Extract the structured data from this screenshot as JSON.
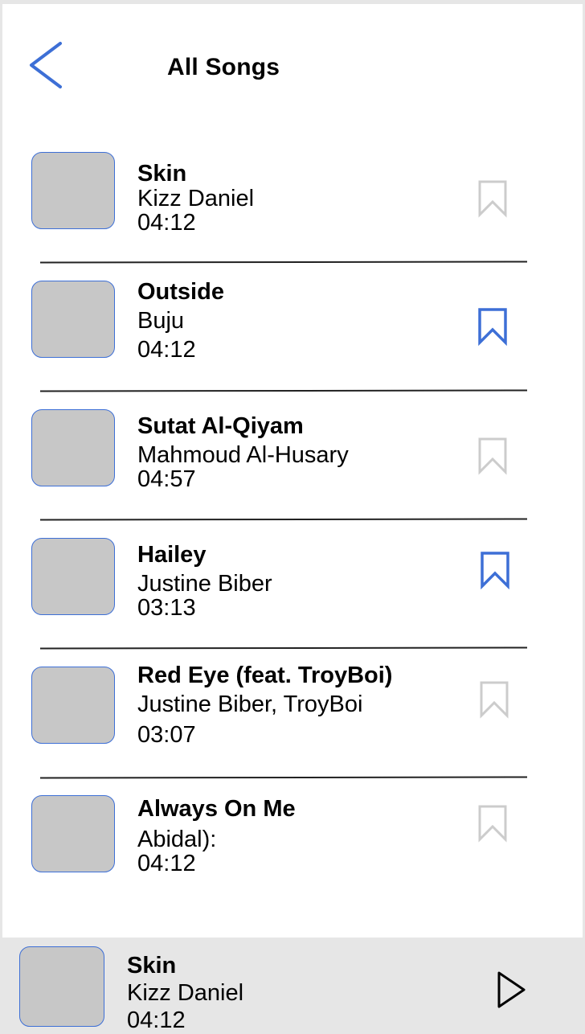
{
  "header": {
    "title": "All Songs",
    "back_icon": "chevron-left-icon"
  },
  "colors": {
    "accent": "#3d6fd6",
    "thumbnail": "#c7c7c7",
    "bookmark_inactive": "#cccccc",
    "player_bg": "#e6e6e6"
  },
  "songs": [
    {
      "title": "Skin",
      "artist": "Kizz Daniel",
      "duration": "04:12",
      "bookmarked": false
    },
    {
      "title": "Outside",
      "artist": "Buju",
      "duration": "04:12",
      "bookmarked": true
    },
    {
      "title": "Sutat Al-Qiyam",
      "artist": "Mahmoud Al-Husary",
      "duration": "04:57",
      "bookmarked": false
    },
    {
      "title": "Hailey",
      "artist": "Justine Biber",
      "duration": "03:13",
      "bookmarked": true
    },
    {
      "title": "Red Eye (feat. TroyBoi)",
      "artist": "Justine Biber, TroyBoi",
      "duration": "03:07",
      "bookmarked": false
    },
    {
      "title": "Always On Me",
      "artist": "Abidal):",
      "duration": "04:12",
      "bookmarked": false
    }
  ],
  "now_playing": {
    "title": "Skin",
    "artist": "Kizz Daniel",
    "duration": "04:12",
    "play_icon": "play-icon"
  }
}
